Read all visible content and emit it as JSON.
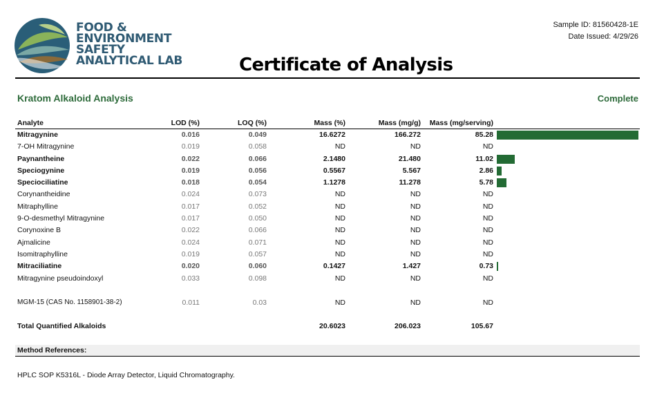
{
  "lab": {
    "name_lines": [
      "FOOD &",
      "ENVIRONMENT",
      "SAFETY",
      "ANALYTICAL LAB"
    ]
  },
  "document": {
    "title": "Certificate of Analysis",
    "sample_id": "Sample ID: 81560428-1E",
    "date_issued": "Date Issued: 4/29/26"
  },
  "section": {
    "title": "Kratom Alkaloid Analysis",
    "status": "Complete"
  },
  "colors": {
    "accent_green": "#2e6b3b",
    "bar_green": "#236b34",
    "logo_blue": "#2f5a73"
  },
  "table": {
    "headers": {
      "analyte": "Analyte",
      "lod": "LOD (%)",
      "loq": "LOQ (%)",
      "mass_pct": "Mass (%)",
      "mass_mg_g": "Mass (mg/g)",
      "mass_serving": "Mass (mg/serving)"
    },
    "rows": [
      {
        "analyte": "Mitragynine",
        "lod": "0.016",
        "loq": "0.049",
        "mass_pct": "16.6272",
        "mass_mg_g": "166.272",
        "mass_serving": "85.28",
        "detected": true,
        "serving_value": 85.28
      },
      {
        "analyte": "7-OH Mitragynine",
        "lod": "0.019",
        "loq": "0.058",
        "mass_pct": "ND",
        "mass_mg_g": "ND",
        "mass_serving": "ND",
        "detected": false,
        "serving_value": 0
      },
      {
        "analyte": "Paynantheine",
        "lod": "0.022",
        "loq": "0.066",
        "mass_pct": "2.1480",
        "mass_mg_g": "21.480",
        "mass_serving": "11.02",
        "detected": true,
        "serving_value": 11.02
      },
      {
        "analyte": "Speciogynine",
        "lod": "0.019",
        "loq": "0.056",
        "mass_pct": "0.5567",
        "mass_mg_g": "5.567",
        "mass_serving": "2.86",
        "detected": true,
        "serving_value": 2.86
      },
      {
        "analyte": "Speciociliatine",
        "lod": "0.018",
        "loq": "0.054",
        "mass_pct": "1.1278",
        "mass_mg_g": "11.278",
        "mass_serving": "5.78",
        "detected": true,
        "serving_value": 5.78
      },
      {
        "analyte": "Corynantheidine",
        "lod": "0.024",
        "loq": "0.073",
        "mass_pct": "ND",
        "mass_mg_g": "ND",
        "mass_serving": "ND",
        "detected": false,
        "serving_value": 0
      },
      {
        "analyte": "Mitraphylline",
        "lod": "0.017",
        "loq": "0.052",
        "mass_pct": "ND",
        "mass_mg_g": "ND",
        "mass_serving": "ND",
        "detected": false,
        "serving_value": 0
      },
      {
        "analyte": "9-O-desmethyl Mitragynine",
        "lod": "0.017",
        "loq": "0.050",
        "mass_pct": "ND",
        "mass_mg_g": "ND",
        "mass_serving": "ND",
        "detected": false,
        "serving_value": 0
      },
      {
        "analyte": "Corynoxine B",
        "lod": "0.022",
        "loq": "0.066",
        "mass_pct": "ND",
        "mass_mg_g": "ND",
        "mass_serving": "ND",
        "detected": false,
        "serving_value": 0
      },
      {
        "analyte": "Ajmalicine",
        "lod": "0.024",
        "loq": "0.071",
        "mass_pct": "ND",
        "mass_mg_g": "ND",
        "mass_serving": "ND",
        "detected": false,
        "serving_value": 0
      },
      {
        "analyte": "Isomitraphylline",
        "lod": "0.019",
        "loq": "0.057",
        "mass_pct": "ND",
        "mass_mg_g": "ND",
        "mass_serving": "ND",
        "detected": false,
        "serving_value": 0
      },
      {
        "analyte": "Mitraciliatine",
        "lod": "0.020",
        "loq": "0.060",
        "mass_pct": "0.1427",
        "mass_mg_g": "1.427",
        "mass_serving": "0.73",
        "detected": true,
        "serving_value": 0.73
      },
      {
        "analyte": "Mitragynine pseudoindoxyl",
        "lod": "0.033",
        "loq": "0.098",
        "mass_pct": "ND",
        "mass_mg_g": "ND",
        "mass_serving": "ND",
        "detected": false,
        "serving_value": 0
      }
    ],
    "extra_row": {
      "analyte": "MGM-15 (CAS No. 1158901-38-2)",
      "lod": "0.011",
      "loq": "0.03",
      "mass_pct": "ND",
      "mass_mg_g": "ND",
      "mass_serving": "ND"
    },
    "total": {
      "label": "Total Quantified Alkaloids",
      "mass_pct": "20.6023",
      "mass_mg_g": "206.023",
      "mass_serving": "105.67"
    }
  },
  "methods": {
    "heading": "Method References:",
    "text": "HPLC SOP K5316L - Diode Array Detector, Liquid Chromatography."
  }
}
